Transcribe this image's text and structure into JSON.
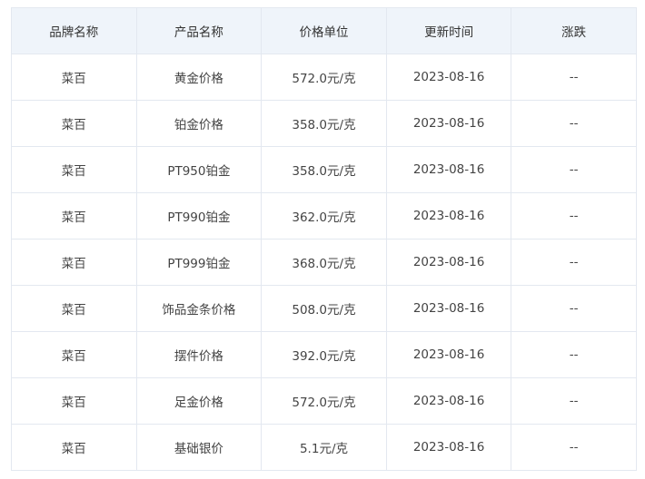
{
  "table": {
    "headers": [
      "品牌名称",
      "产品名称",
      "价格单位",
      "更新时间",
      "涨跌"
    ],
    "rows": [
      [
        "菜百",
        "黄金价格",
        "572.0元/克",
        "2023-08-16",
        "--"
      ],
      [
        "菜百",
        "铂金价格",
        "358.0元/克",
        "2023-08-16",
        "--"
      ],
      [
        "菜百",
        "PT950铂金",
        "358.0元/克",
        "2023-08-16",
        "--"
      ],
      [
        "菜百",
        "PT990铂金",
        "362.0元/克",
        "2023-08-16",
        "--"
      ],
      [
        "菜百",
        "PT999铂金",
        "368.0元/克",
        "2023-08-16",
        "--"
      ],
      [
        "菜百",
        "饰品金条价格",
        "508.0元/克",
        "2023-08-16",
        "--"
      ],
      [
        "菜百",
        "摆件价格",
        "392.0元/克",
        "2023-08-16",
        "--"
      ],
      [
        "菜百",
        "足金价格",
        "572.0元/克",
        "2023-08-16",
        "--"
      ],
      [
        "菜百",
        "基础银价",
        "5.1元/克",
        "2023-08-16",
        "--"
      ]
    ]
  },
  "colors": {
    "header_bg": "#eff4fa",
    "border": "#e3e8f0",
    "text": "#333333"
  }
}
